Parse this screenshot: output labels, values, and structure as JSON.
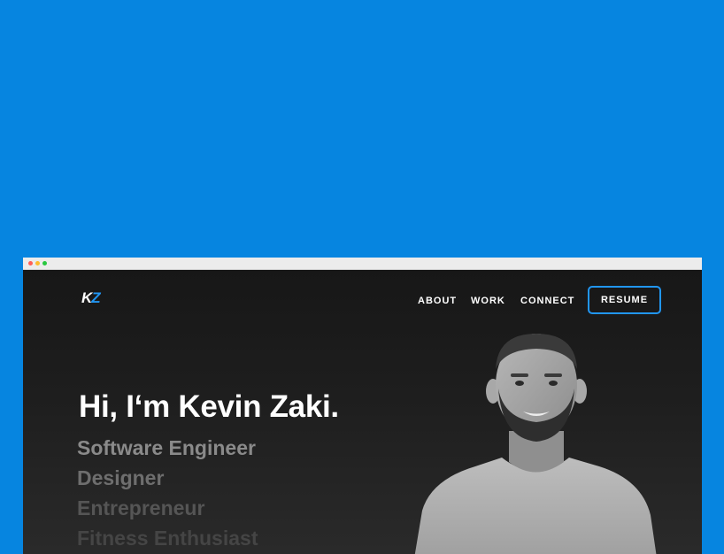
{
  "site": {
    "logo": {
      "k": "K",
      "z": "Z"
    },
    "nav": {
      "about": "ABOUT",
      "work": "WORK",
      "connect": "CONNECT",
      "resume": "RESUME"
    },
    "hero": {
      "headline": "Hi, I‘m Kevin Zaki.",
      "roles": [
        "Software Engineer",
        "Designer",
        "Entrepreneur",
        "Fitness Enthusiast"
      ]
    }
  },
  "colors": {
    "background": "#0685E0",
    "accent": "#2196F3",
    "page_bg": "#1E1E1E"
  }
}
